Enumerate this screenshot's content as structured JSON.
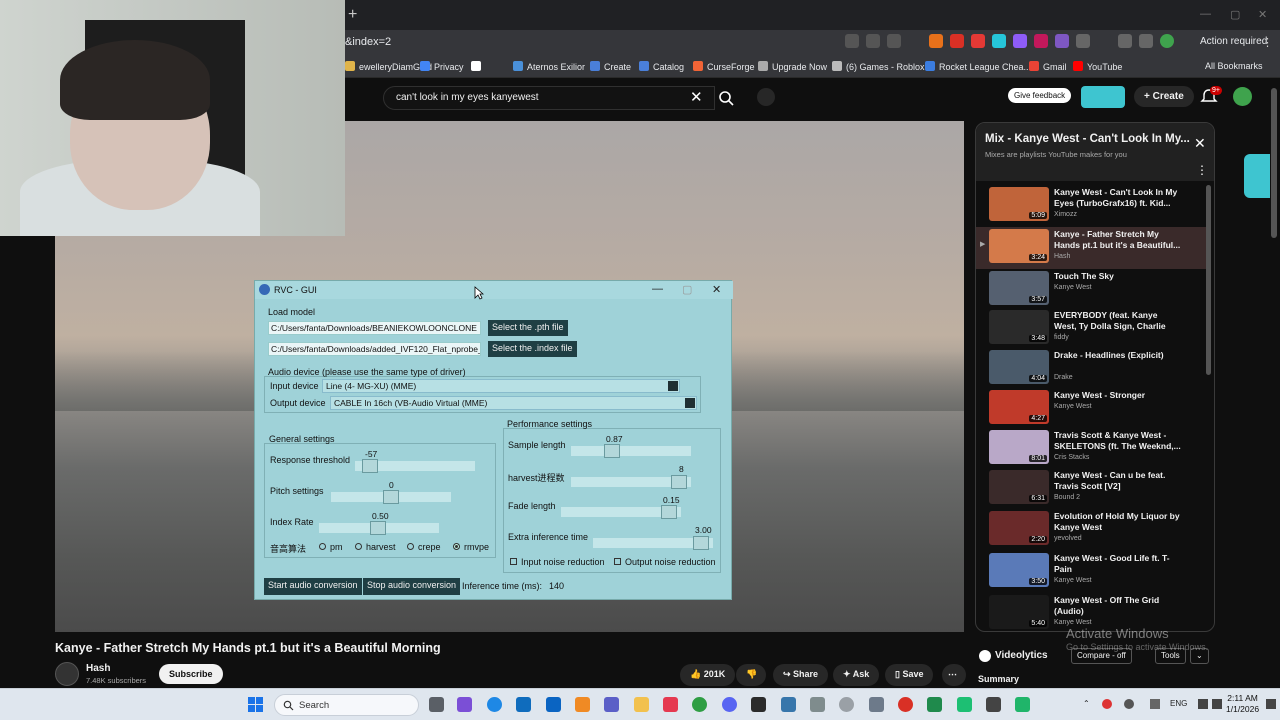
{
  "browser": {
    "url": "&index=2",
    "action_required": "Action required",
    "bookmarks": [
      {
        "label": "ewelleryDiamGold",
        "color": "#e0b44a"
      },
      {
        "label": "Privacy",
        "color": "#4285f4"
      },
      {
        "label": "",
        "color": "#ffffff"
      },
      {
        "label": "Aternos Exilior",
        "color": "#4a90d9"
      },
      {
        "label": "Create",
        "color": "#4a7fd9"
      },
      {
        "label": "Catalog",
        "color": "#4a7fd9"
      },
      {
        "label": "CurseForge",
        "color": "#f16436"
      },
      {
        "label": "Upgrade Now",
        "color": "#aaaaaa"
      },
      {
        "label": "(6) Games - Roblox",
        "color": "#bbbbbb"
      },
      {
        "label": "Rocket League Chea...",
        "color": "#3b7de0"
      },
      {
        "label": "Gmail",
        "color": "#ea4335"
      },
      {
        "label": "YouTube",
        "color": "#ff0000"
      }
    ],
    "all_bookmarks": "All Bookmarks"
  },
  "youtube": {
    "search_query": "can't look in my eyes kanyewest",
    "give_feedback": "Give feedback",
    "create": "Create",
    "notif_count": "9+"
  },
  "rvc": {
    "title": "RVC - GUI",
    "load_model": "Load model",
    "pth_path": "C:/Users/fanta/Downloads/BEANIEKOWLOONCLONE",
    "pth_button": "Select the .pth file",
    "index_path": "C:/Users/fanta/Downloads/added_IVF120_Flat_nprobe_",
    "index_button": "Select the .index file",
    "audio_device_label": "Audio device (please use the same type of driver)",
    "input_device_label": "Input device",
    "input_device_value": "Line (4- MG-XU) (MME)",
    "output_device_label": "Output device",
    "output_device_value": "CABLE In 16ch (VB-Audio Virtual (MME)",
    "general_settings": "General settings",
    "response_threshold_label": "Response threshold",
    "response_threshold_value": "-57",
    "pitch_label": "Pitch settings",
    "pitch_value": "0",
    "index_rate_label": "Index Rate",
    "index_rate_value": "0.50",
    "pitch_algo_label": "音高算法",
    "pitch_algos": [
      "pm",
      "harvest",
      "crepe",
      "rmvpe"
    ],
    "pitch_algo_selected": "rmvpe",
    "performance_settings": "Performance settings",
    "sample_length_label": "Sample length",
    "sample_length_value": "0.87",
    "harvest_label": "harvest进程数",
    "harvest_value": "8",
    "fade_length_label": "Fade length",
    "fade_length_value": "0.15",
    "extra_inference_label": "Extra inference time",
    "extra_inference_value": "3.00",
    "input_noise": "Input noise reduction",
    "output_noise": "Output noise reduction",
    "start_button": "Start audio conversion",
    "stop_button": "Stop audio conversion",
    "inference_time_label": "Inference time (ms):",
    "inference_time_value": "140"
  },
  "playlist": {
    "title": "Mix - Kanye West - Can't Look In My...",
    "subtitle": "Mixes are playlists YouTube makes for you",
    "items": [
      {
        "title": "Kanye West - Can't Look In My Eyes (TurboGrafx16) ft. Kid...",
        "channel": "Ximozz",
        "duration": "5:09",
        "color": "#c0643a"
      },
      {
        "title": "Kanye - Father Stretch My Hands pt.1 but it's a Beautiful...",
        "channel": "Hash",
        "duration": "3:24",
        "color": "#d47a4a"
      },
      {
        "title": "Touch The Sky",
        "channel": "Kanye West",
        "duration": "3:57",
        "color": "#556070"
      },
      {
        "title": "EVERYBODY (feat. Kanye West, Ty Dolla Sign, Charlie Wilson)",
        "channel": "fiddy",
        "duration": "3:48",
        "color": "#2a2a2a"
      },
      {
        "title": "Drake - Headlines (Explicit)",
        "channel": "Drake",
        "duration": "4:04",
        "color": "#4a5a6a"
      },
      {
        "title": "Kanye West - Stronger",
        "channel": "Kanye West",
        "duration": "4:27",
        "color": "#c03a2a"
      },
      {
        "title": "Travis Scott & Kanye West - SKELETONS (ft. The Weeknd,...",
        "channel": "Cris Stacks",
        "duration": "8:01",
        "color": "#b9a8c8"
      },
      {
        "title": "Kanye West - Can u be feat. Travis Scott [V2]",
        "channel": "Bound 2",
        "duration": "6:31",
        "color": "#3a2a2a"
      },
      {
        "title": "Evolution of Hold My Liquor by Kanye West",
        "channel": "yevolved",
        "duration": "2:20",
        "color": "#6a2a2a"
      },
      {
        "title": "Kanye West - Good Life ft. T-Pain",
        "channel": "Kanye West",
        "duration": "3:50",
        "color": "#5a7ab8"
      },
      {
        "title": "Kanye West - Off The Grid (Audio)",
        "channel": "Kanye West",
        "duration": "5:40",
        "color": "#1a1a1a"
      }
    ]
  },
  "video": {
    "title": "Kanye - Father Stretch My Hands pt.1 but it's a Beautiful Morning",
    "channel": "Hash",
    "subscribers": "7.48K subscribers",
    "subscribe": "Subscribe",
    "likes": "201K",
    "share": "Share",
    "ask": "Ask",
    "save": "Save"
  },
  "videolytics": {
    "name": "Videolytics",
    "compare": "Compare - off",
    "tools": "Tools",
    "summary": "Summary"
  },
  "watermark": {
    "line1": "Activate Windows",
    "line2": "Go to Settings to activate Windows."
  },
  "taskbar": {
    "search": "Search",
    "lang": "ENG",
    "time": "2:11 AM",
    "date": "1/1/2026"
  }
}
